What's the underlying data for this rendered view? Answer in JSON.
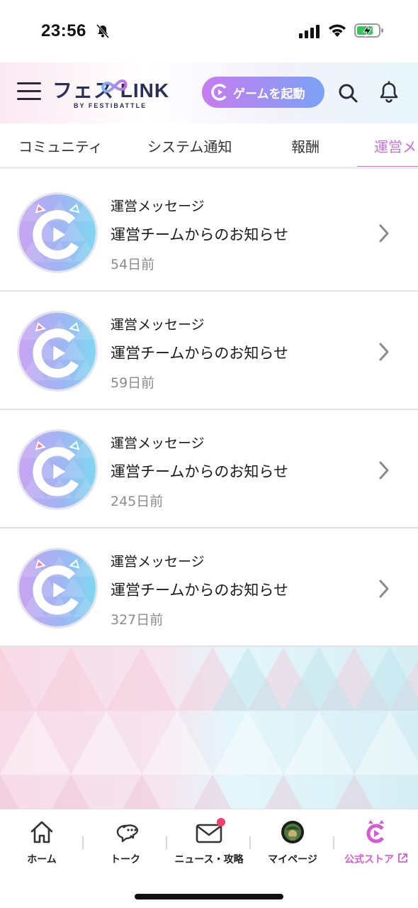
{
  "status_bar": {
    "time": "23:56"
  },
  "header": {
    "logo_text": "フェス LINK",
    "logo_sub": "BY FESTIBATTLE",
    "launch_button": "ゲームを起動"
  },
  "tabs": [
    {
      "label": "コミュニティ"
    },
    {
      "label": "システム通知"
    },
    {
      "label": "報酬"
    },
    {
      "label": "運営メ"
    }
  ],
  "messages": [
    {
      "sender": "運営メッセージ",
      "title": "運営チームからのお知らせ",
      "time": "54日前"
    },
    {
      "sender": "運営メッセージ",
      "title": "運営チームからのお知らせ",
      "time": "59日前"
    },
    {
      "sender": "運営メッセージ",
      "title": "運営チームからのお知らせ",
      "time": "245日前"
    },
    {
      "sender": "運営メッセージ",
      "title": "運営チームからのお知らせ",
      "time": "327日前"
    }
  ],
  "bottom_nav": [
    {
      "label": "ホーム",
      "icon": "home-icon"
    },
    {
      "label": "トーク",
      "icon": "chat-icon"
    },
    {
      "label": "ニュース・攻略",
      "icon": "mail-icon"
    },
    {
      "label": "マイページ",
      "icon": "profile-avatar-icon"
    },
    {
      "label": "公式ストア",
      "icon": "store-logo-icon"
    }
  ],
  "colors": {
    "accent": "#c46fe6",
    "store": "#d85ad2",
    "badge": "#f0416d"
  }
}
